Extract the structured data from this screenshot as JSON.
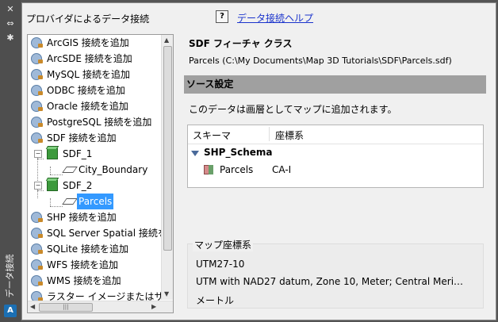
{
  "side_strip": {
    "title": "データ接続",
    "close_glyph": "✕",
    "autohide_glyph": "⇔",
    "properties_glyph": "✱"
  },
  "left": {
    "title": "プロバイダによるデータ接続",
    "tree": [
      {
        "label": "ArcGIS 接続を追加"
      },
      {
        "label": "ArcSDE 接続を追加"
      },
      {
        "label": "MySQL 接続を追加"
      },
      {
        "label": "ODBC 接続を追加"
      },
      {
        "label": "Oracle 接続を追加"
      },
      {
        "label": "PostgreSQL 接続を追加"
      },
      {
        "label": "SDF 接続を追加"
      },
      {
        "label": "SDF_1"
      },
      {
        "label": "City_Boundary"
      },
      {
        "label": "SDF_2"
      },
      {
        "label": "Parcels"
      },
      {
        "label": "SHP 接続を追加"
      },
      {
        "label": "SQL Server Spatial 接続を"
      },
      {
        "label": "SQLite 接続を追加"
      },
      {
        "label": "WFS 接続を追加"
      },
      {
        "label": "WMS 接続を追加"
      },
      {
        "label": "ラスター イメージまたはサー"
      }
    ],
    "hscroll_grip": "|||"
  },
  "help": {
    "icon": "?",
    "link": "データ接続ヘルプ"
  },
  "right": {
    "feature_title": "SDF フィーチャ クラス",
    "path": "Parcels (C:\\My Documents\\Map 3D Tutorials\\SDF\\Parcels.sdf)",
    "source_header": "ソース設定",
    "source_desc": "このデータは画層としてマップに追加されます。",
    "schema": {
      "col1": "スキーマ",
      "col2": "座標系",
      "schema_name": "SHP_Schema",
      "item_name": "Parcels",
      "item_cs": "CA-I"
    },
    "map_cs": {
      "title": "マップ座標系",
      "code": "UTM27-10",
      "desc": "UTM with NAD27 datum, Zone 10, Meter; Central Meri…",
      "unit": "メートル"
    }
  }
}
